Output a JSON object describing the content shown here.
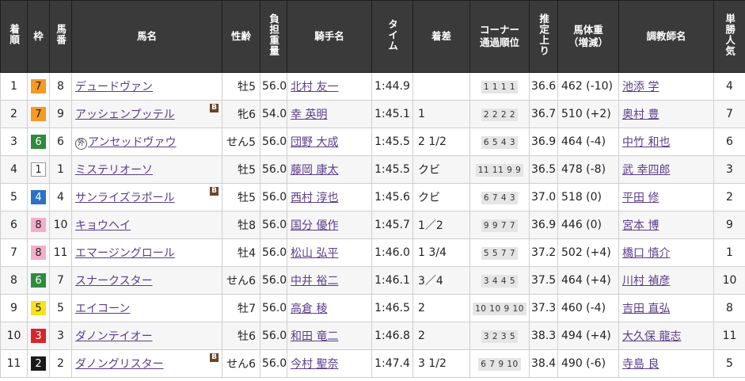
{
  "headers": {
    "finish": "着順",
    "frame": "枠",
    "number": "馬番",
    "horse": "馬名",
    "sex_age": "性齢",
    "weight_carried": "負担重量",
    "jockey": "騎手名",
    "time": "タイム",
    "margin": "着差",
    "corners": "コーナー\n通過順位",
    "last3f": "推定上り",
    "body_weight": "馬体重\n（増減）",
    "trainer": "調教師名",
    "popularity": "単勝人気"
  },
  "colors": {
    "header_bg": "#3a3a3a",
    "link": "#5a3d8a",
    "blinker_badge": "#6b4426",
    "row_alt": "#f6f6f6"
  },
  "rows": [
    {
      "finish": "1",
      "frame": "7",
      "frame_bg": "#f49a25",
      "frame_fg": "#222222",
      "frame_border": "#f49a25",
      "number": "8",
      "horse": "デュードヴァン",
      "prefix": "",
      "blinker": "",
      "sex_age": "牡5",
      "weight": "56.0",
      "jockey": "北村 友一",
      "time": "1:44.9",
      "margin": "",
      "corners": "1 1 1 1",
      "last3f": "36.6",
      "body_weight": "462 (-10)",
      "trainer": "池添 学",
      "popularity": "4"
    },
    {
      "finish": "2",
      "frame": "7",
      "frame_bg": "#f49a25",
      "frame_fg": "#222222",
      "frame_border": "#f49a25",
      "number": "9",
      "horse": "アッシェンプッテル",
      "prefix": "",
      "blinker": "B",
      "sex_age": "牝6",
      "weight": "54.0",
      "jockey": "幸 英明",
      "time": "1:45.1",
      "margin": "1",
      "corners": "2 2 2 2",
      "last3f": "36.7",
      "body_weight": "510 (+2)",
      "trainer": "奥村 豊",
      "popularity": "7"
    },
    {
      "finish": "3",
      "frame": "6",
      "frame_bg": "#2e8b3d",
      "frame_fg": "#ffffff",
      "frame_border": "#2e8b3d",
      "number": "6",
      "horse": "アンセッドヴァウ",
      "prefix": "外",
      "blinker": "",
      "sex_age": "せん5",
      "weight": "56.0",
      "jockey": "団野 大成",
      "time": "1:45.5",
      "margin": "2 1/2",
      "corners": "6 5 4 3",
      "last3f": "36.9",
      "body_weight": "464 (-4)",
      "trainer": "中竹 和也",
      "popularity": "6"
    },
    {
      "finish": "4",
      "frame": "1",
      "frame_bg": "#ffffff",
      "frame_fg": "#222222",
      "frame_border": "#999999",
      "number": "1",
      "horse": "ミステリオーソ",
      "prefix": "",
      "blinker": "",
      "sex_age": "牡5",
      "weight": "56.0",
      "jockey": "藤岡 康太",
      "time": "1:45.5",
      "margin": "クビ",
      "corners": "11 11 9 9",
      "last3f": "36.5",
      "body_weight": "478 (-8)",
      "trainer": "武 幸四郎",
      "popularity": "3"
    },
    {
      "finish": "5",
      "frame": "4",
      "frame_bg": "#2a72c9",
      "frame_fg": "#ffffff",
      "frame_border": "#2a72c9",
      "number": "4",
      "horse": "サンライズラポール",
      "prefix": "",
      "blinker": "B",
      "sex_age": "牡5",
      "weight": "56.0",
      "jockey": "西村 淳也",
      "time": "1:45.6",
      "margin": "クビ",
      "corners": "6 7 4 3",
      "last3f": "37.0",
      "body_weight": "518 (0)",
      "trainer": "平田 修",
      "popularity": "2"
    },
    {
      "finish": "6",
      "frame": "8",
      "frame_bg": "#f5aeca",
      "frame_fg": "#222222",
      "frame_border": "#f5aeca",
      "number": "10",
      "horse": "キョウヘイ",
      "prefix": "",
      "blinker": "",
      "sex_age": "牡8",
      "weight": "56.0",
      "jockey": "国分 優作",
      "time": "1:45.7",
      "margin": "1／2",
      "corners": "9 9 7 7",
      "last3f": "36.9",
      "body_weight": "446 (0)",
      "trainer": "宮本 博",
      "popularity": "9"
    },
    {
      "finish": "7",
      "frame": "8",
      "frame_bg": "#f5aeca",
      "frame_fg": "#222222",
      "frame_border": "#f5aeca",
      "number": "11",
      "horse": "エマージングロール",
      "prefix": "",
      "blinker": "",
      "sex_age": "牡4",
      "weight": "56.0",
      "jockey": "松山 弘平",
      "time": "1:46.0",
      "margin": "1 3/4",
      "corners": "5 5 7 7",
      "last3f": "37.2",
      "body_weight": "502 (+4)",
      "trainer": "橋口 慎介",
      "popularity": "1"
    },
    {
      "finish": "8",
      "frame": "6",
      "frame_bg": "#2e8b3d",
      "frame_fg": "#ffffff",
      "frame_border": "#2e8b3d",
      "number": "7",
      "horse": "スナークスター",
      "prefix": "",
      "blinker": "",
      "sex_age": "せん6",
      "weight": "56.0",
      "jockey": "中井 裕二",
      "time": "1:46.1",
      "margin": "3／4",
      "corners": "3 4 4 5",
      "last3f": "37.5",
      "body_weight": "464 (+4)",
      "trainer": "川村 禎彦",
      "popularity": "10"
    },
    {
      "finish": "9",
      "frame": "5",
      "frame_bg": "#f5e21c",
      "frame_fg": "#222222",
      "frame_border": "#f5e21c",
      "number": "5",
      "horse": "エイコーン",
      "prefix": "",
      "blinker": "",
      "sex_age": "牡7",
      "weight": "56.0",
      "jockey": "高倉 稜",
      "time": "1:46.5",
      "margin": "2",
      "corners": "10 10 9 10",
      "last3f": "37.3",
      "body_weight": "460 (-4)",
      "trainer": "吉田 直弘",
      "popularity": "8"
    },
    {
      "finish": "10",
      "frame": "3",
      "frame_bg": "#d7262b",
      "frame_fg": "#ffffff",
      "frame_border": "#d7262b",
      "number": "3",
      "horse": "ダノンテイオー",
      "prefix": "",
      "blinker": "",
      "sex_age": "牡6",
      "weight": "56.0",
      "jockey": "和田 竜二",
      "time": "1:46.8",
      "margin": "2",
      "corners": "3 2 3 5",
      "last3f": "38.3",
      "body_weight": "494 (+4)",
      "trainer": "大久保 龍志",
      "popularity": "11"
    },
    {
      "finish": "11",
      "frame": "2",
      "frame_bg": "#1a1a1a",
      "frame_fg": "#ffffff",
      "frame_border": "#1a1a1a",
      "number": "2",
      "horse": "ダノングリスター",
      "prefix": "",
      "blinker": "B",
      "sex_age": "せん6",
      "weight": "56.0",
      "jockey": "今村 聖奈",
      "time": "1:47.4",
      "margin": "3 1/2",
      "corners": "6 7 9 10",
      "last3f": "38.4",
      "body_weight": "490 (-6)",
      "trainer": "寺島 良",
      "popularity": "5"
    }
  ]
}
